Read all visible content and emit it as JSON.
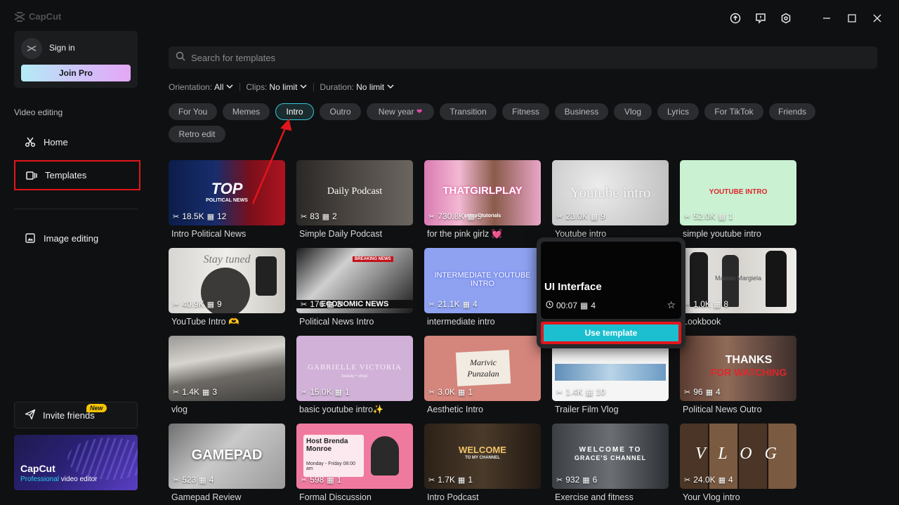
{
  "app": {
    "name": "CapCut"
  },
  "window_controls": [
    "upload-icon",
    "feedback-icon",
    "settings-icon",
    "minimize-icon",
    "maximize-icon",
    "close-icon"
  ],
  "sidebar": {
    "sign_in": "Sign in",
    "join_pro": "Join Pro",
    "section_title": "Video editing",
    "nav": {
      "home": "Home",
      "templates": "Templates",
      "image_editing": "Image editing"
    },
    "invite": {
      "label": "Invite friends",
      "badge": "New"
    },
    "promo": {
      "title": "CapCut",
      "sub_highlight": "Professional",
      "sub_rest": " video editor"
    }
  },
  "search": {
    "placeholder": "Search for templates",
    "value": ""
  },
  "filters": {
    "orientation": {
      "label": "Orientation:",
      "value": "All"
    },
    "clips": {
      "label": "Clips:",
      "value": "No limit"
    },
    "duration": {
      "label": "Duration:",
      "value": "No limit"
    }
  },
  "categories": [
    "For You",
    "Memes",
    "Intro",
    "Outro",
    "New year",
    "Transition",
    "Fitness",
    "Business",
    "Vlog",
    "Lyrics",
    "For TikTok",
    "Friends",
    "Retro edit"
  ],
  "active_category": "Intro",
  "templates": [
    {
      "title": "Intro Political News",
      "uses": "18.5K",
      "clips": "12",
      "art": "TOP",
      "art2": "POLITICAL NEWS"
    },
    {
      "title": "Simple Daily Podcast",
      "uses": "83",
      "clips": "2",
      "art": "Daily Podcast"
    },
    {
      "title": "for the pink girlz 💓",
      "uses": "730.8K",
      "clips": "9",
      "art": "THATGIRLPLAY",
      "art2": "setup • tutorials"
    },
    {
      "title": "Youtube intro",
      "uses": "23.0K",
      "clips": "9",
      "art": "Youtube intro"
    },
    {
      "title": "simple youtube intro",
      "uses": "52.0K",
      "clips": "1",
      "art": "YOUTUBE INTRO"
    },
    {
      "title": "YouTube Intro 🫶",
      "uses": "40.9K",
      "clips": "9",
      "art": "Stay tuned"
    },
    {
      "title": "Political News Intro",
      "uses": "176",
      "clips": "3",
      "art": "ECONOMIC NEWS",
      "art2": "BREAKING NEWS"
    },
    {
      "title": "intermediate intro",
      "uses": "21.1K",
      "clips": "4",
      "art": "INTERMEDIATE YOUTUBE INTRO"
    },
    {
      "title": "UI Interface",
      "uses": "",
      "clips": "",
      "art": ""
    },
    {
      "title": "Lookbook",
      "uses": "1.0K",
      "clips": "8",
      "art": "Maison Margiela"
    },
    {
      "title": "vlog",
      "uses": "1.4K",
      "clips": "3",
      "art": ""
    },
    {
      "title": "basic youtube intro✨",
      "uses": "15.0K",
      "clips": "1",
      "art": "GABRIELLE VICTORIA",
      "art2": "beauty • vlogs"
    },
    {
      "title": "Aesthetic Intro",
      "uses": "3.0K",
      "clips": "1",
      "art": "Marivic Punzalan"
    },
    {
      "title": "Trailer Film Vlog",
      "uses": "1.4K",
      "clips": "10",
      "art": ""
    },
    {
      "title": "Political News Outro",
      "uses": "96",
      "clips": "4",
      "art": "THANKS",
      "art2": "FOR WATCHING"
    },
    {
      "title": "Gamepad Review",
      "uses": "523",
      "clips": "4",
      "art": "GAMEPAD"
    },
    {
      "title": "Formal Discussion",
      "uses": "598",
      "clips": "1",
      "art": "Host Brenda Monroe",
      "art2": "Monday - Friday 08:00 am"
    },
    {
      "title": "Intro Podcast",
      "uses": "1.7K",
      "clips": "1",
      "art": "WELCOME",
      "art2": "TO MY CHANNEL"
    },
    {
      "title": "Exercise and fitness",
      "uses": "932",
      "clips": "6",
      "art": "WELCOME TO",
      "art2": "GRACE'S CHANNEL"
    },
    {
      "title": "Your Vlog intro",
      "uses": "24.0K",
      "clips": "4",
      "art": "V L O G"
    }
  ],
  "popup": {
    "title": "UI Interface",
    "duration": "00:07",
    "clips": "4",
    "button": "Use template"
  }
}
